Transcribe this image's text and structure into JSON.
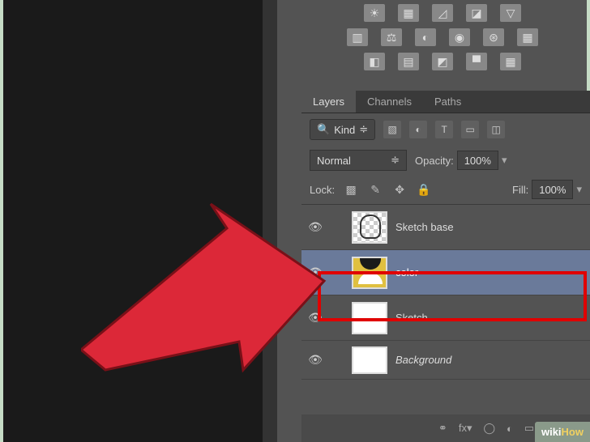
{
  "tabs": {
    "layers": "Layers",
    "channels": "Channels",
    "paths": "Paths"
  },
  "filter": {
    "kind": "Kind"
  },
  "blend": {
    "mode": "Normal",
    "opacity_label": "Opacity:",
    "opacity_value": "100%"
  },
  "lock": {
    "label": "Lock:",
    "fill_label": "Fill:",
    "fill_value": "100%"
  },
  "layers_list": [
    {
      "name": "Sketch base"
    },
    {
      "name": "color"
    },
    {
      "name": "Sketch"
    },
    {
      "name": "Background"
    }
  ],
  "watermark": {
    "prefix": "wiki",
    "suffix": "How"
  }
}
